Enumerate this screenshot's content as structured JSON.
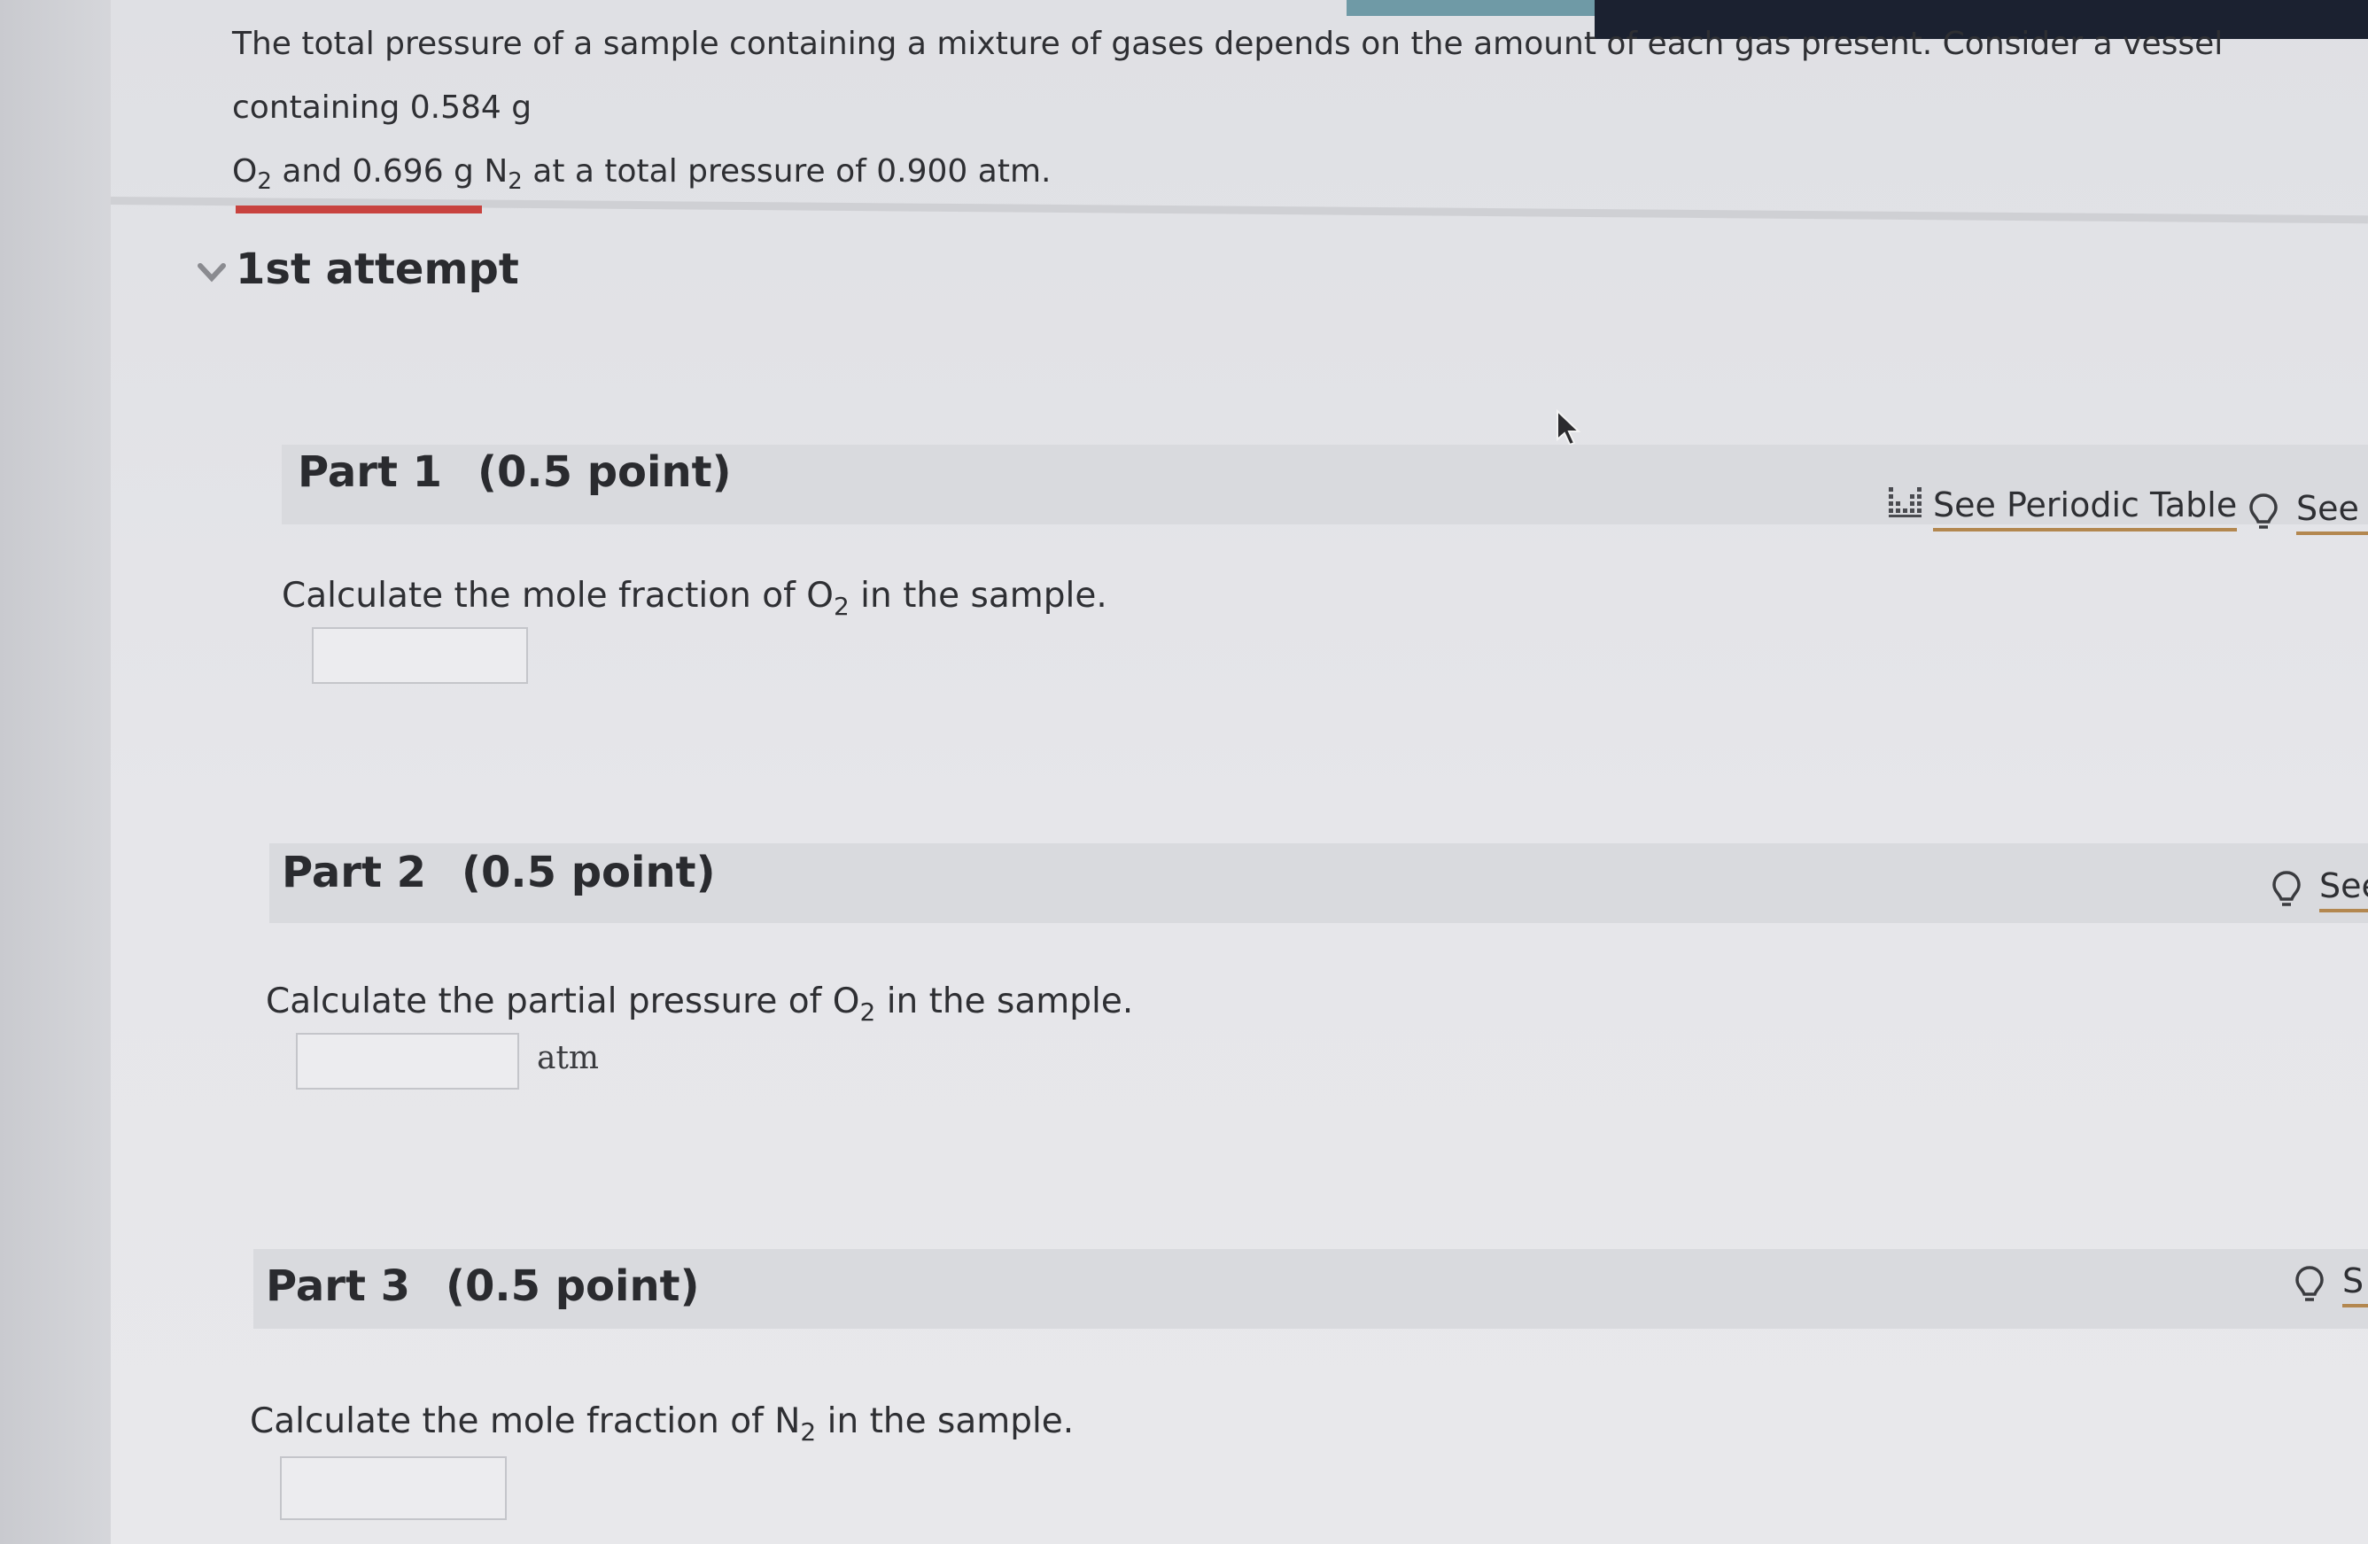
{
  "problem": {
    "line1": "The total pressure of a sample containing a mixture of gases depends on the amount of each gas present. Consider a vessel containing",
    "mass_o2": "0.584 g",
    "o2": "O",
    "o2_sub": "2",
    "and_text": "and",
    "mass_n2": "0.696 g",
    "n2": "N",
    "n2_sub": "2",
    "pressure_text": "at a total pressure of",
    "pressure_value": "0.900 atm."
  },
  "attempt": {
    "label": "1st attempt"
  },
  "parts": [
    {
      "title": "Part 1",
      "points": "(0.5 point)",
      "q_before": "Calculate the mole fraction of",
      "q_species": "O",
      "q_sub": "2",
      "q_after": "in the sample.",
      "unit": "",
      "tools": [
        "See Periodic Table",
        "See H"
      ]
    },
    {
      "title": "Part 2",
      "points": "(0.5 point)",
      "q_before": "Calculate the partial pressure of",
      "q_species": "O",
      "q_sub": "2",
      "q_after": "in the sample.",
      "unit": "atm",
      "tools": [
        "See"
      ]
    },
    {
      "title": "Part 3",
      "points": "(0.5 point)",
      "q_before": "Calculate the mole fraction of",
      "q_species": "N",
      "q_sub": "2",
      "q_after": "in the sample.",
      "unit": "",
      "tools": [
        "S"
      ]
    }
  ],
  "progress": {
    "fraction": 0.065
  },
  "colors": {
    "progress_bar": "#c8433f",
    "link_underline": "#b3874f",
    "topbar": "#1b2130"
  },
  "icons": {
    "attempt_toggle": "chevron-down-icon",
    "periodic_table": "periodic-table-icon",
    "hint": "lightbulb-icon",
    "cursor": "mouse-cursor-icon"
  }
}
